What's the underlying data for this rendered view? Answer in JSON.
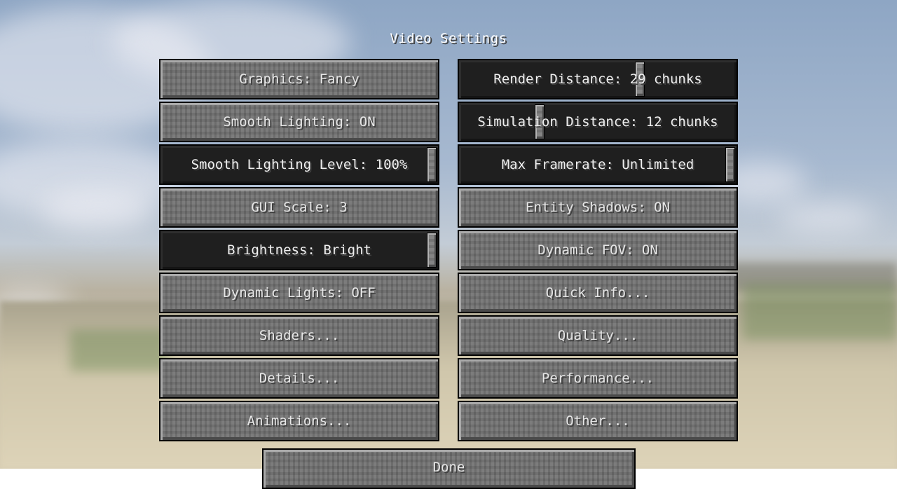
{
  "screen": {
    "title": "Video Settings"
  },
  "left_column": [
    {
      "label": "Graphics: Fancy"
    },
    {
      "label": "Smooth Lighting: ON"
    },
    {
      "label": "Smooth Lighting Level: 100%",
      "slider_value": 1.0
    },
    {
      "label": "GUI Scale: 3"
    },
    {
      "label": "Brightness: Bright",
      "slider_value": 1.0
    },
    {
      "label": "Dynamic Lights: OFF"
    },
    {
      "label": "Shaders..."
    },
    {
      "label": "Details..."
    },
    {
      "label": "Animations..."
    }
  ],
  "right_column": [
    {
      "label": "Render Distance: 29 chunks",
      "slider_value": 0.66
    },
    {
      "label": "Simulation Distance: 12 chunks",
      "slider_value": 0.28
    },
    {
      "label": "Max Framerate: Unlimited",
      "slider_value": 1.0
    },
    {
      "label": "Entity Shadows: ON"
    },
    {
      "label": "Dynamic FOV: ON"
    },
    {
      "label": "Quick Info..."
    },
    {
      "label": "Quality..."
    },
    {
      "label": "Performance..."
    },
    {
      "label": "Other..."
    }
  ],
  "done": {
    "label": "Done"
  }
}
